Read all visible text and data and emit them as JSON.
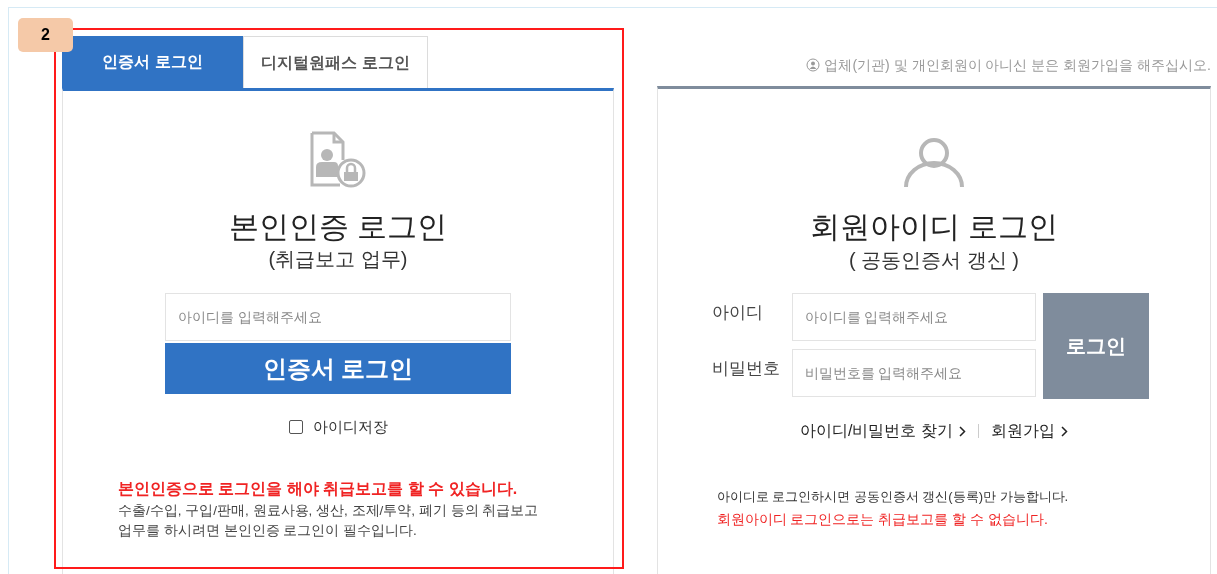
{
  "annotation": {
    "badge": "2"
  },
  "cert_login": {
    "tabs": [
      {
        "label": "인증서 로그인",
        "selected": true
      },
      {
        "label": "디지털원패스 로그인",
        "selected": false
      }
    ],
    "title": "본인인증 로그인",
    "subtitle": "(취급보고 업무)",
    "id_placeholder": "아이디를 입력해주세요",
    "button": "인증서 로그인",
    "save_id": {
      "label": "아이디저장",
      "checked": false
    },
    "warning": "본인인증으로 로그인을 해야 취급보고를 할 수 있습니다.",
    "description": "수출/수입, 구입/판매, 원료사용, 생산, 조제/투약, 폐기 등의 취급보고 업무를 하시려면 본인인증 로그인이 필수입니다."
  },
  "member_login": {
    "notice": "업체(기관) 및 개인회원이 아니신 분은 회원가입을 해주십시오.",
    "title": "회원아이디 로그인",
    "subtitle": "( 공동인증서 갱신 )",
    "fields": [
      {
        "label": "아이디",
        "placeholder": "아이디를 입력해주세요"
      },
      {
        "label": "비밀번호",
        "placeholder": "비밀번호를 입력해주세요"
      }
    ],
    "button": "로그인",
    "links": [
      "아이디/비밀번호 찾기",
      "회원가입"
    ],
    "info": "아이디로 로그인하시면 공동인증서 갱신(등록)만 가능합니다.",
    "warning": "회원아이디 로그인으로는 취급보고를 할 수 없습니다."
  }
}
